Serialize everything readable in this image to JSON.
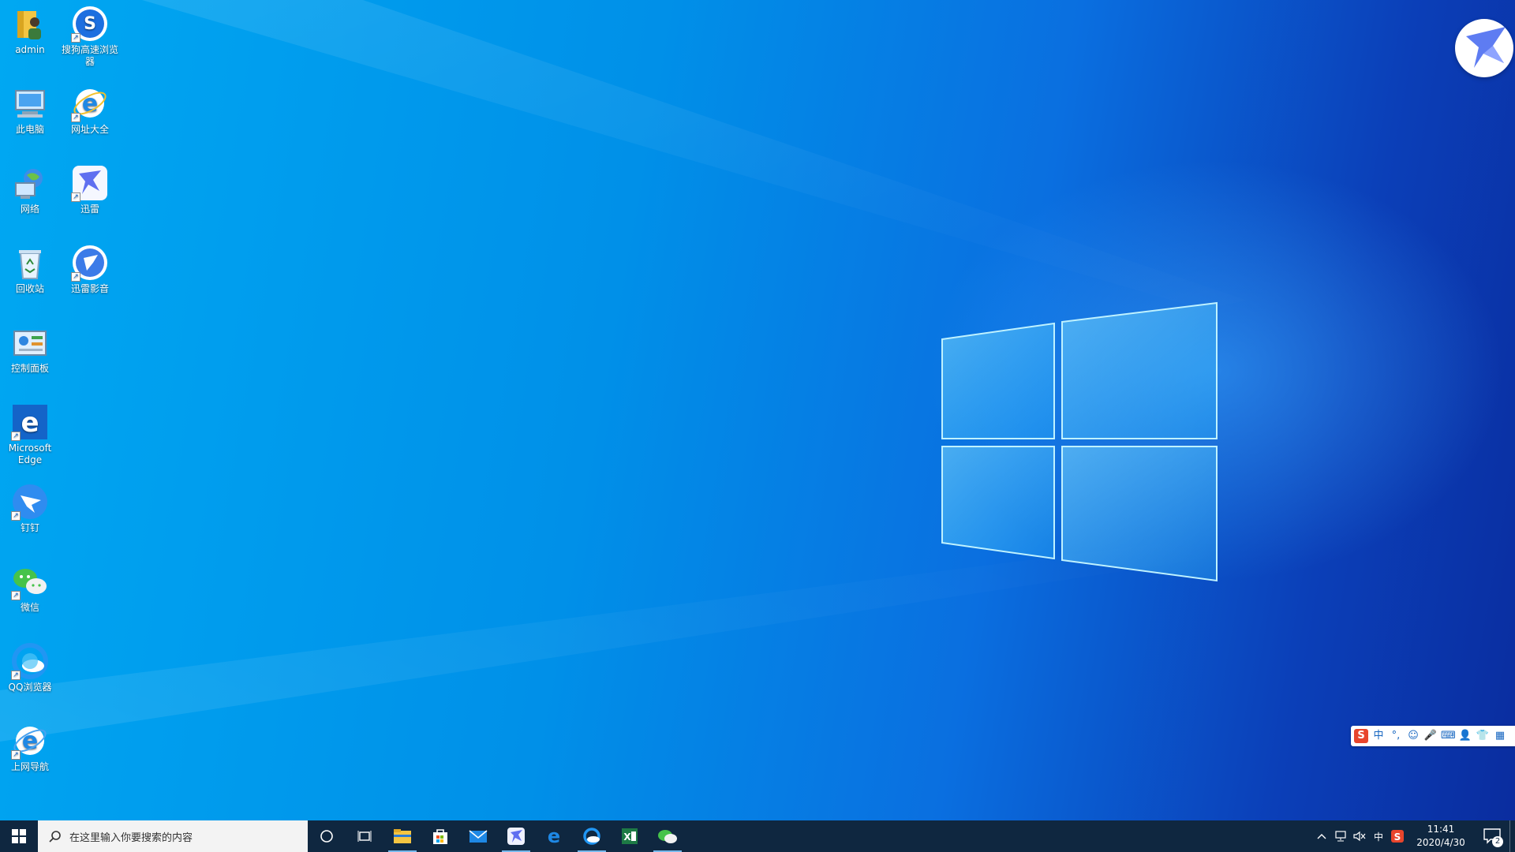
{
  "desktop": {
    "icons": [
      {
        "label": "admin",
        "icon": "user-folder-icon"
      },
      {
        "label": "搜狗高速浏览器",
        "icon": "sogou-browser-icon"
      },
      {
        "label": "此电脑",
        "icon": "computer-icon"
      },
      {
        "label": "网址大全",
        "icon": "ie-icon"
      },
      {
        "label": "网络",
        "icon": "network-icon"
      },
      {
        "label": "迅雷",
        "icon": "thunder-icon"
      },
      {
        "label": "回收站",
        "icon": "recycle-bin-icon"
      },
      {
        "label": "迅雷影音",
        "icon": "thunder-player-icon"
      },
      {
        "label": "控制面板",
        "icon": "control-panel-icon"
      },
      {
        "label": "Microsoft Edge",
        "icon": "edge-icon"
      },
      {
        "label": "钉钉",
        "icon": "dingtalk-icon"
      },
      {
        "label": "微信",
        "icon": "wechat-icon"
      },
      {
        "label": "QQ浏览器",
        "icon": "qq-browser-icon"
      },
      {
        "label": "上网导航",
        "icon": "ie-icon"
      }
    ]
  },
  "ime_bar": {
    "items": [
      "S",
      "中",
      "°,",
      "☺",
      "🎤",
      "⌨",
      "👤",
      "👕",
      "▦"
    ]
  },
  "taskbar": {
    "search_placeholder": "在这里输入你要搜索的内容",
    "pinned": [
      {
        "name": "file-explorer",
        "active": true
      },
      {
        "name": "store",
        "active": false
      },
      {
        "name": "mail",
        "active": false
      },
      {
        "name": "thunder",
        "active": true
      },
      {
        "name": "edge",
        "active": false
      },
      {
        "name": "qq-browser",
        "active": true
      },
      {
        "name": "excel",
        "active": false
      },
      {
        "name": "wechat",
        "active": true
      }
    ],
    "tray": {
      "ime_label": "中",
      "time": "11:41",
      "date": "2020/4/30",
      "notification_count": "2"
    }
  },
  "colors": {
    "taskbar_bg": "#0f2740",
    "accent": "#76b9ed",
    "wallpaper_blue": "#0090e8"
  }
}
